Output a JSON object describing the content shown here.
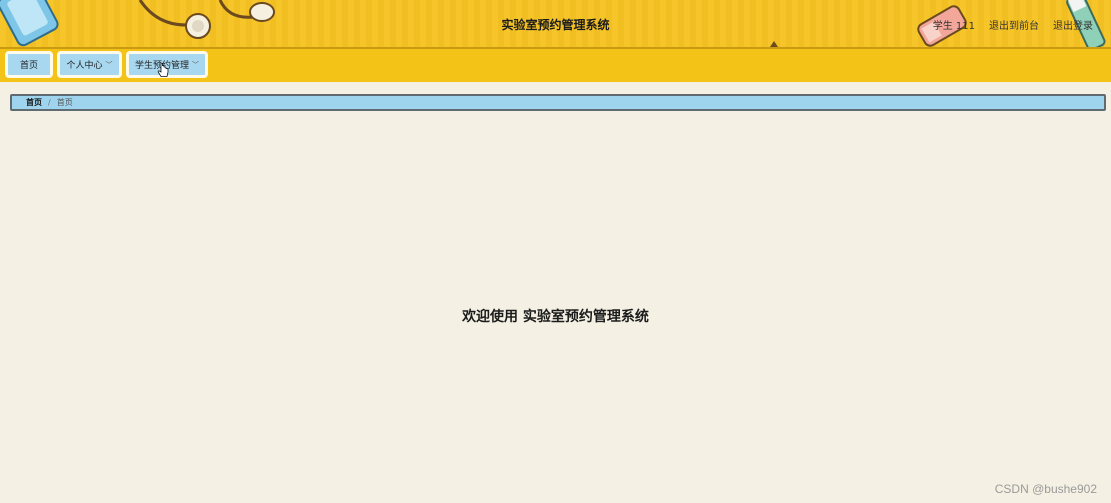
{
  "header": {
    "title": "实验室预约管理系统",
    "user_label": "学生 111",
    "back_to_front": "退出到前台",
    "logout": "退出登录"
  },
  "nav": {
    "items": [
      {
        "label": "首页",
        "has_dropdown": false
      },
      {
        "label": "个人中心",
        "has_dropdown": true
      },
      {
        "label": "学生预约管理",
        "has_dropdown": true
      }
    ],
    "caret": "﹀"
  },
  "breadcrumb": {
    "home": "首页",
    "separator": "/",
    "current": "首页"
  },
  "main": {
    "welcome": "欢迎使用 实验室预约管理系统"
  },
  "watermark": "CSDN @bushe902",
  "colors": {
    "header_bg": "#f6c52a",
    "nav_bg": "#f3c318",
    "nav_button_bg": "#a7d8f0",
    "page_bg": "#f4f0e3",
    "breadcrumb_bg": "#9fd4ee"
  }
}
